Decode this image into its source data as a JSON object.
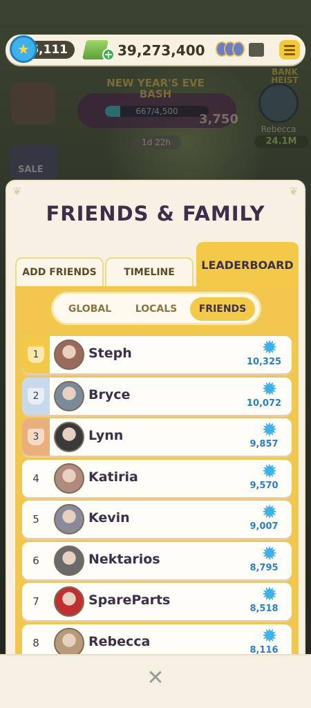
{
  "topbar": {
    "stars": "6,111",
    "cash": "39,273,400",
    "menu_icon": "hamburger-icon"
  },
  "event": {
    "title": "NEW YEAR'S EVE BASH",
    "progress_text": "667/4,500",
    "progress_fraction": 0.148,
    "points": "3,750",
    "timer": "1d 22h"
  },
  "heist": {
    "label": "BANK HEIST",
    "name": "Rebecca",
    "value": "24.1M"
  },
  "shop": {
    "sale_label": "SALE"
  },
  "panel": {
    "title": "FRIENDS & FAMILY",
    "tabs": [
      {
        "label": "ADD FRIENDS",
        "active": false
      },
      {
        "label": "TIMELINE",
        "active": false
      },
      {
        "label": "LEADERBOARD",
        "active": true
      }
    ],
    "segments": [
      {
        "label": "GLOBAL",
        "active": false
      },
      {
        "label": "LOCALS",
        "active": false
      },
      {
        "label": "FRIENDS",
        "active": true
      }
    ]
  },
  "leaderboard": [
    {
      "rank": "1",
      "name": "Steph",
      "score": "10,325",
      "badge": "gold"
    },
    {
      "rank": "2",
      "name": "Bryce",
      "score": "10,072",
      "badge": "silver"
    },
    {
      "rank": "3",
      "name": "Lynn",
      "score": "9,857",
      "badge": "bronze"
    },
    {
      "rank": "4",
      "name": "Katiria",
      "score": "9,570",
      "badge": ""
    },
    {
      "rank": "5",
      "name": "Kevin",
      "score": "9,007",
      "badge": ""
    },
    {
      "rank": "6",
      "name": "Nektarios",
      "score": "8,795",
      "badge": ""
    },
    {
      "rank": "7",
      "name": "SpareParts",
      "score": "8,518",
      "badge": ""
    },
    {
      "rank": "8",
      "name": "Rebecca",
      "score": "8,116",
      "badge": ""
    }
  ],
  "colors": {
    "gold": "#f3c94a",
    "silver": "#c9d9ec",
    "bronze": "#e9b07e",
    "star_blue": "#3fb0e8",
    "score_blue": "#2a7fc0"
  },
  "close_label": "✕"
}
